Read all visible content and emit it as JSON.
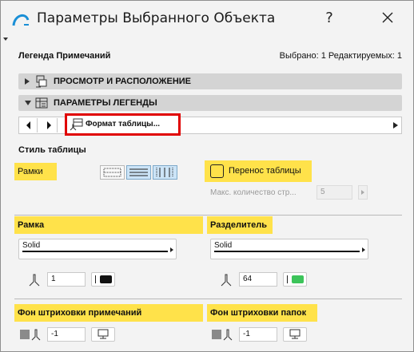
{
  "window": {
    "title": "Параметры Выбранного Объекта",
    "help_label": "?"
  },
  "header": {
    "object_type": "Легенда Примечаний",
    "selection_status": "Выбрано: 1 Редактируемых: 1"
  },
  "sections": {
    "view": "ПРОСМОТР И РАСПОЛОЖЕНИЕ",
    "legend": "ПАРАМЕТРЫ ЛЕГЕНДЫ"
  },
  "nav": {
    "current_page": "Формат таблицы..."
  },
  "table_style": {
    "heading": "Стиль таблицы",
    "frames_label": "Рамки",
    "wrap_label": "Перенос таблицы",
    "max_count_label": "Макс. количество стр...",
    "max_count_value": "5"
  },
  "frame": {
    "label": "Рамка",
    "line_type": "Solid",
    "pen_number": "1",
    "pen_color": "#111111"
  },
  "separator": {
    "label": "Разделитель",
    "line_type": "Solid",
    "pen_number": "64",
    "pen_color": "#3cc45a"
  },
  "notes_fill": {
    "label": "Фон штриховки примечаний",
    "pen_number": "-1"
  },
  "folders_fill": {
    "label": "Фон штриховки папок",
    "pen_number": "-1"
  },
  "colors": {
    "highlight": "#ffe24a",
    "callout": "#e00000",
    "toggle_active": "#cce4f7"
  },
  "icons": [
    "app-logo-icon",
    "help-icon",
    "close-icon",
    "expand-triangle-icon",
    "view-placement-icon",
    "legend-params-icon",
    "prev-page-icon",
    "next-page-icon",
    "table-format-icon",
    "pen-icon",
    "fill-swatch-icon",
    "monitor-icon"
  ]
}
